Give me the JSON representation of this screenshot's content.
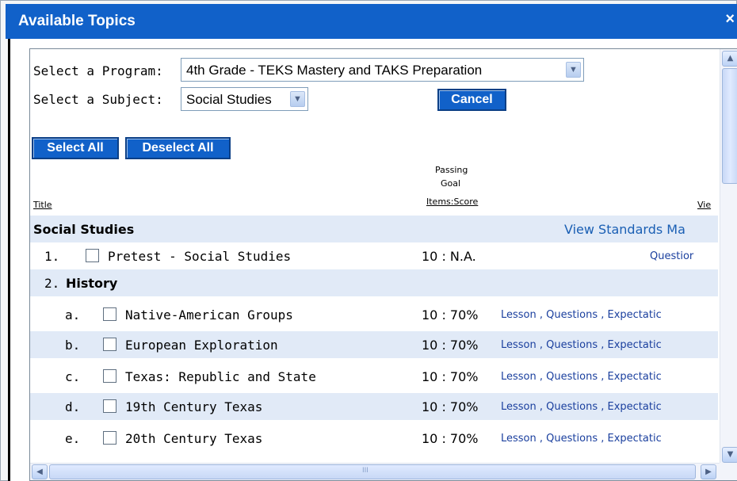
{
  "window": {
    "title": "Available Topics",
    "close_glyph": "×"
  },
  "form": {
    "program_label": "Select a Program:",
    "program_value": "4th Grade - TEKS Mastery and TAKS Preparation",
    "subject_label": "Select a Subject:",
    "subject_value": "Social Studies",
    "cancel_label": "Cancel",
    "select_all_label": "Select All",
    "deselect_all_label": "Deselect All"
  },
  "table_header": {
    "title": "Title",
    "passing": "Passing",
    "goal": "Goal",
    "items_score": "Items:Score",
    "view": "Vie"
  },
  "section": {
    "title": "Social Studies",
    "view_link": "View Standards Ma"
  },
  "pretest": {
    "number": "1.",
    "label": "Pretest - Social Studies",
    "score": "10 : N.A.",
    "link": "Questior"
  },
  "history": {
    "number": "2.",
    "label": "History"
  },
  "topics": [
    {
      "letter": "a.",
      "label": "Native-American Groups",
      "score": "10 : 70%",
      "lesson": "Lesson",
      "sep1": " , ",
      "questions": "Questions",
      "sep2": " , ",
      "expect": "Expectatic"
    },
    {
      "letter": "b.",
      "label": "European Exploration",
      "score": "10 : 70%",
      "lesson": "Lesson",
      "sep1": " , ",
      "questions": "Questions",
      "sep2": " , ",
      "expect": "Expectatic"
    },
    {
      "letter": "c.",
      "label": "Texas: Republic and State",
      "score": "10 : 70%",
      "lesson": "Lesson",
      "sep1": " , ",
      "questions": "Questions",
      "sep2": " , ",
      "expect": "Expectatic"
    },
    {
      "letter": "d.",
      "label": "19th Century Texas",
      "score": "10 : 70%",
      "lesson": "Lesson",
      "sep1": " , ",
      "questions": "Questions",
      "sep2": " , ",
      "expect": "Expectatic"
    },
    {
      "letter": "e.",
      "label": "20th Century Texas",
      "score": "10 : 70%",
      "lesson": "Lesson",
      "sep1": " , ",
      "questions": "Questions",
      "sep2": " , ",
      "expect": "Expectatic"
    }
  ],
  "scroll": {
    "up": "▲",
    "down": "▼",
    "left": "◀",
    "right": "▶",
    "grip": "III",
    "dropdown": "▼"
  },
  "colors": {
    "title_bar": "#1161c9",
    "band": "#e1eaf7",
    "link": "#1a3f9e"
  }
}
